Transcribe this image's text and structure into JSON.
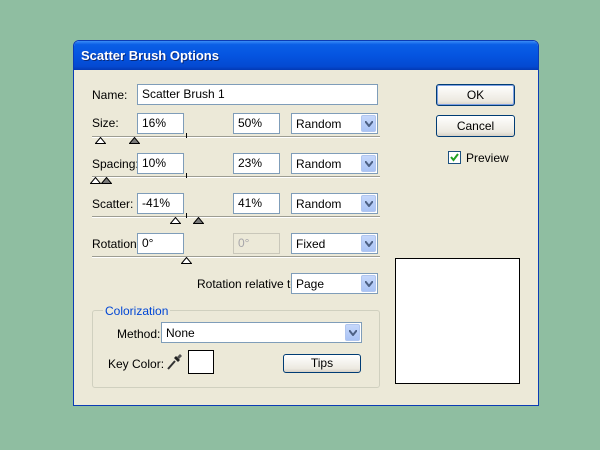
{
  "window": {
    "title": "Scatter Brush Options"
  },
  "name": {
    "label": "Name:",
    "value": "Scatter Brush 1"
  },
  "size": {
    "label": "Size:",
    "min": "16%",
    "max": "50%",
    "mode": "Random"
  },
  "spacing": {
    "label": "Spacing:",
    "min": "10%",
    "max": "23%",
    "mode": "Random"
  },
  "scatter": {
    "label": "Scatter:",
    "min": "-41%",
    "max": "41%",
    "mode": "Random"
  },
  "rotation": {
    "label": "Rotation:",
    "min": "0°",
    "max": "0°",
    "mode": "Fixed"
  },
  "rotation_relative": {
    "label": "Rotation relative to:",
    "value": "Page"
  },
  "colorization": {
    "title": "Colorization",
    "method_label": "Method:",
    "method_value": "None",
    "key_color_label": "Key Color:",
    "tips_label": "Tips"
  },
  "buttons": {
    "ok": "OK",
    "cancel": "Cancel"
  },
  "preview": {
    "label": "Preview",
    "checked": true
  },
  "icons": {
    "eyedropper": "eyedropper-icon",
    "dropdown": "chevron-down-icon",
    "check": "check-icon"
  }
}
